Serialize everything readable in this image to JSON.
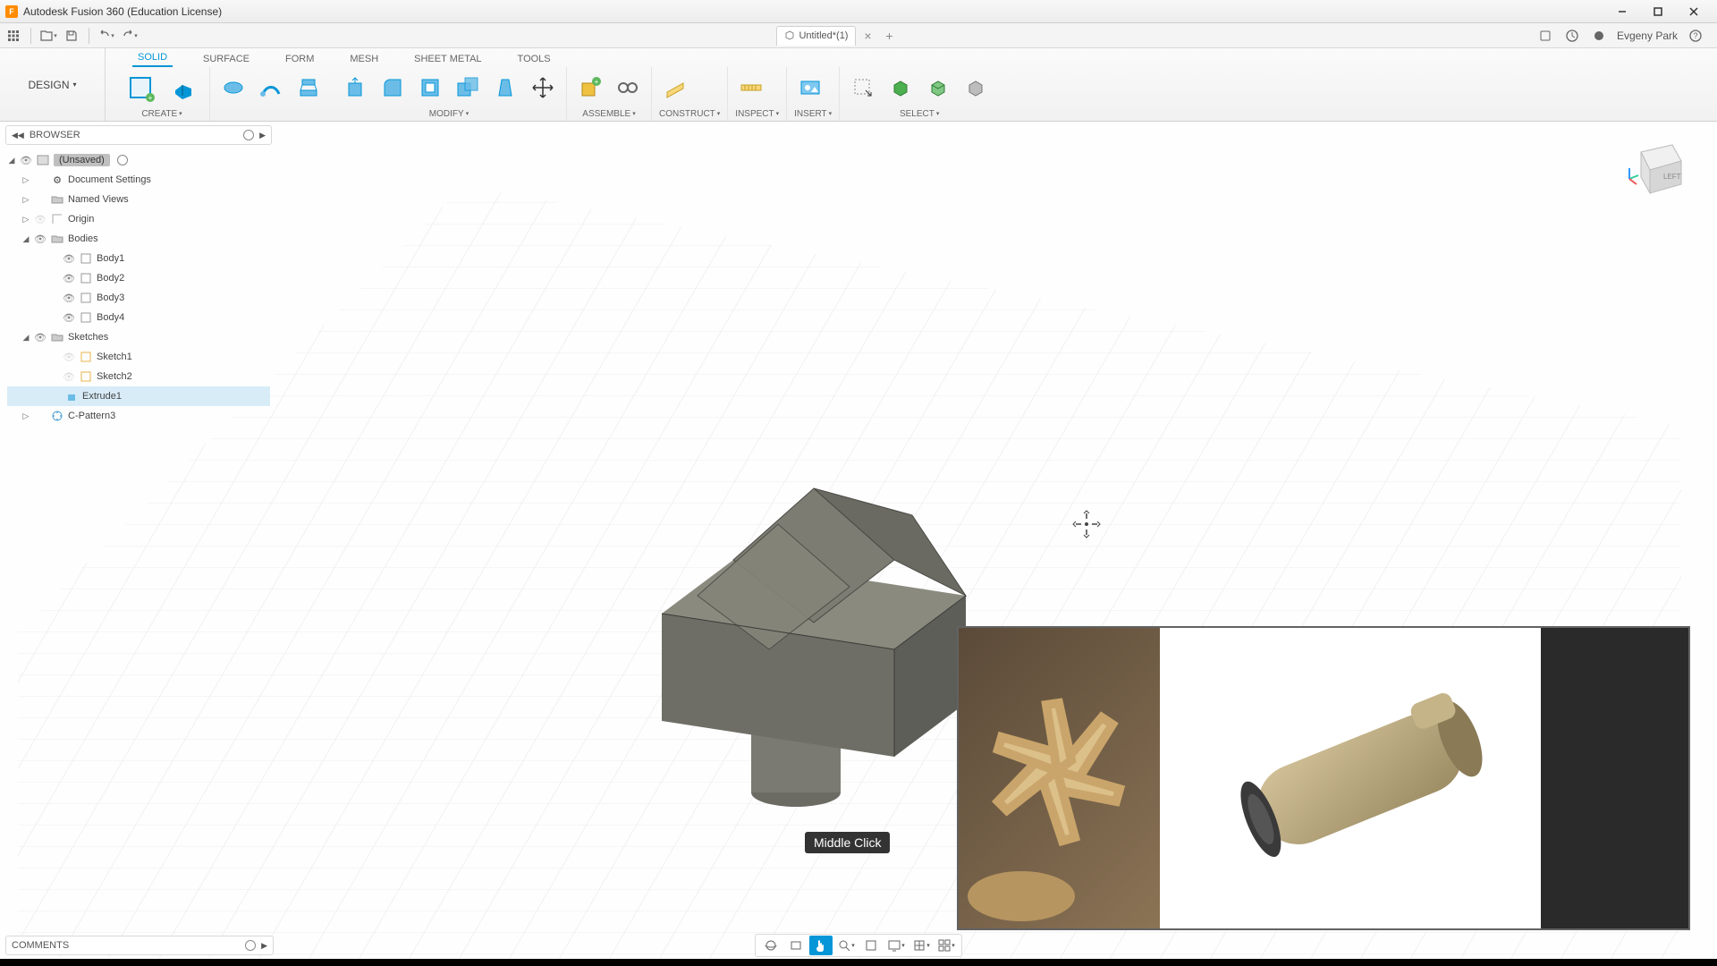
{
  "title": "Autodesk Fusion 360 (Education License)",
  "logo_letter": "F",
  "doc_tab": "Untitled*(1)",
  "qat_right": {
    "user": "Evgeny Park"
  },
  "workspace": "DESIGN",
  "ribbon_tabs": [
    "SOLID",
    "SURFACE",
    "FORM",
    "MESH",
    "SHEET METAL",
    "TOOLS"
  ],
  "ribbon_active": 0,
  "ribbon_groups": {
    "create": "CREATE",
    "modify": "MODIFY",
    "assemble": "ASSEMBLE",
    "construct": "CONSTRUCT",
    "inspect": "INSPECT",
    "insert": "INSERT",
    "select": "SELECT"
  },
  "browser": {
    "title": "BROWSER",
    "root": "(Unsaved)",
    "nodes": {
      "doc_settings": "Document Settings",
      "named_views": "Named Views",
      "origin": "Origin",
      "bodies": "Bodies",
      "body1": "Body1",
      "body2": "Body2",
      "body3": "Body3",
      "body4": "Body4",
      "sketches": "Sketches",
      "sketch1": "Sketch1",
      "sketch2": "Sketch2",
      "extrude1": "Extrude1",
      "cpattern3": "C-Pattern3"
    }
  },
  "comments": "COMMENTS",
  "tooltip": "Middle Click",
  "viewcube_face": "LEFT"
}
